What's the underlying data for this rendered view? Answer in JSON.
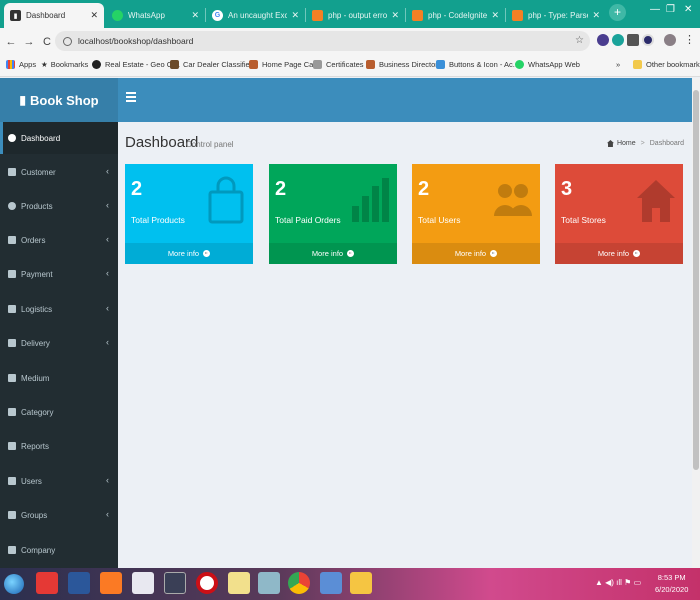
{
  "browser": {
    "tabs": [
      {
        "title": "Dashboard",
        "active": true,
        "icon": "bookshop-favicon"
      },
      {
        "title": "WhatsApp",
        "active": false,
        "icon": "whatsapp-icon"
      },
      {
        "title": "An uncaught Exception...",
        "active": false,
        "icon": "google-icon"
      },
      {
        "title": "php - output error uses...",
        "active": false,
        "icon": "stackoverflow-icon"
      },
      {
        "title": "php - CodeIgniter - Fo...",
        "active": false,
        "icon": "stackoverflow-icon"
      },
      {
        "title": "php - Type: ParseError i...",
        "active": false,
        "icon": "stackoverflow-icon"
      }
    ],
    "url": "localhost/bookshop/dashboard",
    "bookmarks": [
      "Apps",
      "Bookmarks",
      "Real Estate - Geo Cl...",
      "Car Dealer Classifie...",
      "Home Page Cars",
      "Certificates",
      "Business Directory",
      "Buttons & Icon - Ac...",
      "WhatsApp Web"
    ],
    "other_bookmarks": "Other bookmarks"
  },
  "app": {
    "brand": "Book Shop",
    "sidebar": {
      "items": [
        {
          "label": "Dashboard",
          "icon": "dashboard-icon",
          "has_submenu": false,
          "active": true
        },
        {
          "label": "Customer",
          "icon": "customer-icon",
          "has_submenu": true
        },
        {
          "label": "Products",
          "icon": "products-icon",
          "has_submenu": true
        },
        {
          "label": "Orders",
          "icon": "cart-icon",
          "has_submenu": true
        },
        {
          "label": "Payment",
          "icon": "payment-icon",
          "has_submenu": true
        },
        {
          "label": "Logistics",
          "icon": "truck-icon",
          "has_submenu": true
        },
        {
          "label": "Delivery",
          "icon": "delivery-icon",
          "has_submenu": true
        },
        {
          "label": "Medium",
          "icon": "medium-icon",
          "has_submenu": false
        },
        {
          "label": "Category",
          "icon": "tag-icon",
          "has_submenu": false
        },
        {
          "label": "Reports",
          "icon": "chart-icon",
          "has_submenu": false
        },
        {
          "label": "Users",
          "icon": "users-icon",
          "has_submenu": true
        },
        {
          "label": "Groups",
          "icon": "groups-icon",
          "has_submenu": true
        },
        {
          "label": "Company",
          "icon": "building-icon",
          "has_submenu": false
        }
      ]
    },
    "page": {
      "title": "Dashboard",
      "subtitle": "Control panel",
      "breadcrumb": {
        "home": "Home",
        "current": "Dashboard"
      }
    },
    "stats": [
      {
        "value": "2",
        "label": "Total Products",
        "link": "More info",
        "color": "#00c0ef",
        "icon": "shopping-bag-icon"
      },
      {
        "value": "2",
        "label": "Total Paid Orders",
        "link": "More info",
        "color": "#00a65a",
        "icon": "bar-chart-icon"
      },
      {
        "value": "2",
        "label": "Total Users",
        "link": "More info",
        "color": "#f39c12",
        "icon": "users-icon"
      },
      {
        "value": "3",
        "label": "Total Stores",
        "link": "More info",
        "color": "#dd4b39",
        "icon": "home-icon"
      }
    ]
  },
  "taskbar": {
    "time": "8:53 PM",
    "date": "6/20/2020"
  }
}
